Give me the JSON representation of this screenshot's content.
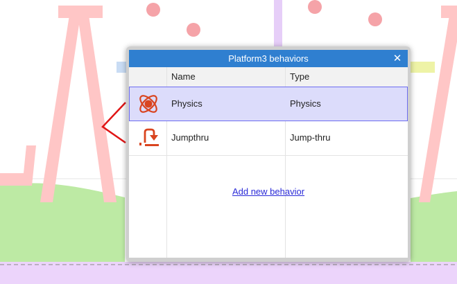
{
  "dialog": {
    "title": "Platform3 behaviors",
    "close_glyph": "✕",
    "columns": {
      "icon": "",
      "name": "Name",
      "type": "Type"
    },
    "rows": [
      {
        "icon": "physics-icon",
        "name": "Physics",
        "type": "Physics",
        "selected": true
      },
      {
        "icon": "jumpthru-icon",
        "name": "Jumpthru",
        "type": "Jump-thru",
        "selected": false
      }
    ],
    "add_link": "Add new behavior"
  },
  "colors": {
    "titlebar": "#2f7fd0",
    "selection_fill": "#dcdcfb",
    "selection_border": "#6c6cf0",
    "link": "#2a2ad8",
    "icon": "#d9441f"
  }
}
